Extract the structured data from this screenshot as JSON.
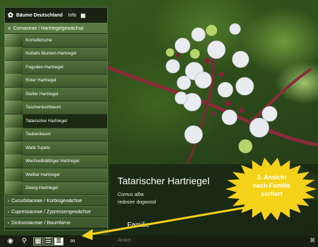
{
  "app": {
    "title": "Bäume Deutschland",
    "info_label": "Info"
  },
  "sidebar": {
    "open_family": "Cornaceae / Hartriegelgewächse",
    "items": [
      {
        "label": "Kornelkirsche"
      },
      {
        "label": "Nuttalls Blumen-Hartriegel"
      },
      {
        "label": "Pagoden-Hartriegel"
      },
      {
        "label": "Roter Hartriegel"
      },
      {
        "label": "Steifer Hartriegel"
      },
      {
        "label": "Taschentuchbaum"
      },
      {
        "label": "Tatarischer Hartriegel"
      },
      {
        "label": "Taubenbaum"
      },
      {
        "label": "Wald-Tupelo"
      },
      {
        "label": "Wechselblättriger Hartriegel"
      },
      {
        "label": "Weißer Hartriegel"
      },
      {
        "label": "Zwerg-Hartriegel"
      }
    ],
    "selected_index": 6,
    "collapsed_families": [
      {
        "label": "Cucurbitaceae / Kürbisgewächse"
      },
      {
        "label": "Cupressaceae / Zypressengewächse"
      },
      {
        "label": "Dicksoniaceae / Baumfarne"
      }
    ]
  },
  "detail": {
    "title": "Tatarischer Hartriegel",
    "latin_name": "Cornus alba",
    "common_name": "redosier dogwood",
    "section_label": "Familie",
    "similar_label": "Ähnlich"
  },
  "callout": {
    "line1": "3. Ansicht",
    "line2": "nach Familie",
    "line3": "sortiert",
    "color": "#f4d21a"
  },
  "toolbar": {
    "icons": [
      "eye-icon",
      "search-icon",
      "grid-view-icon",
      "list-view-icon",
      "family-view-icon",
      "binoculars-icon"
    ],
    "active_view": "family-view-icon"
  }
}
